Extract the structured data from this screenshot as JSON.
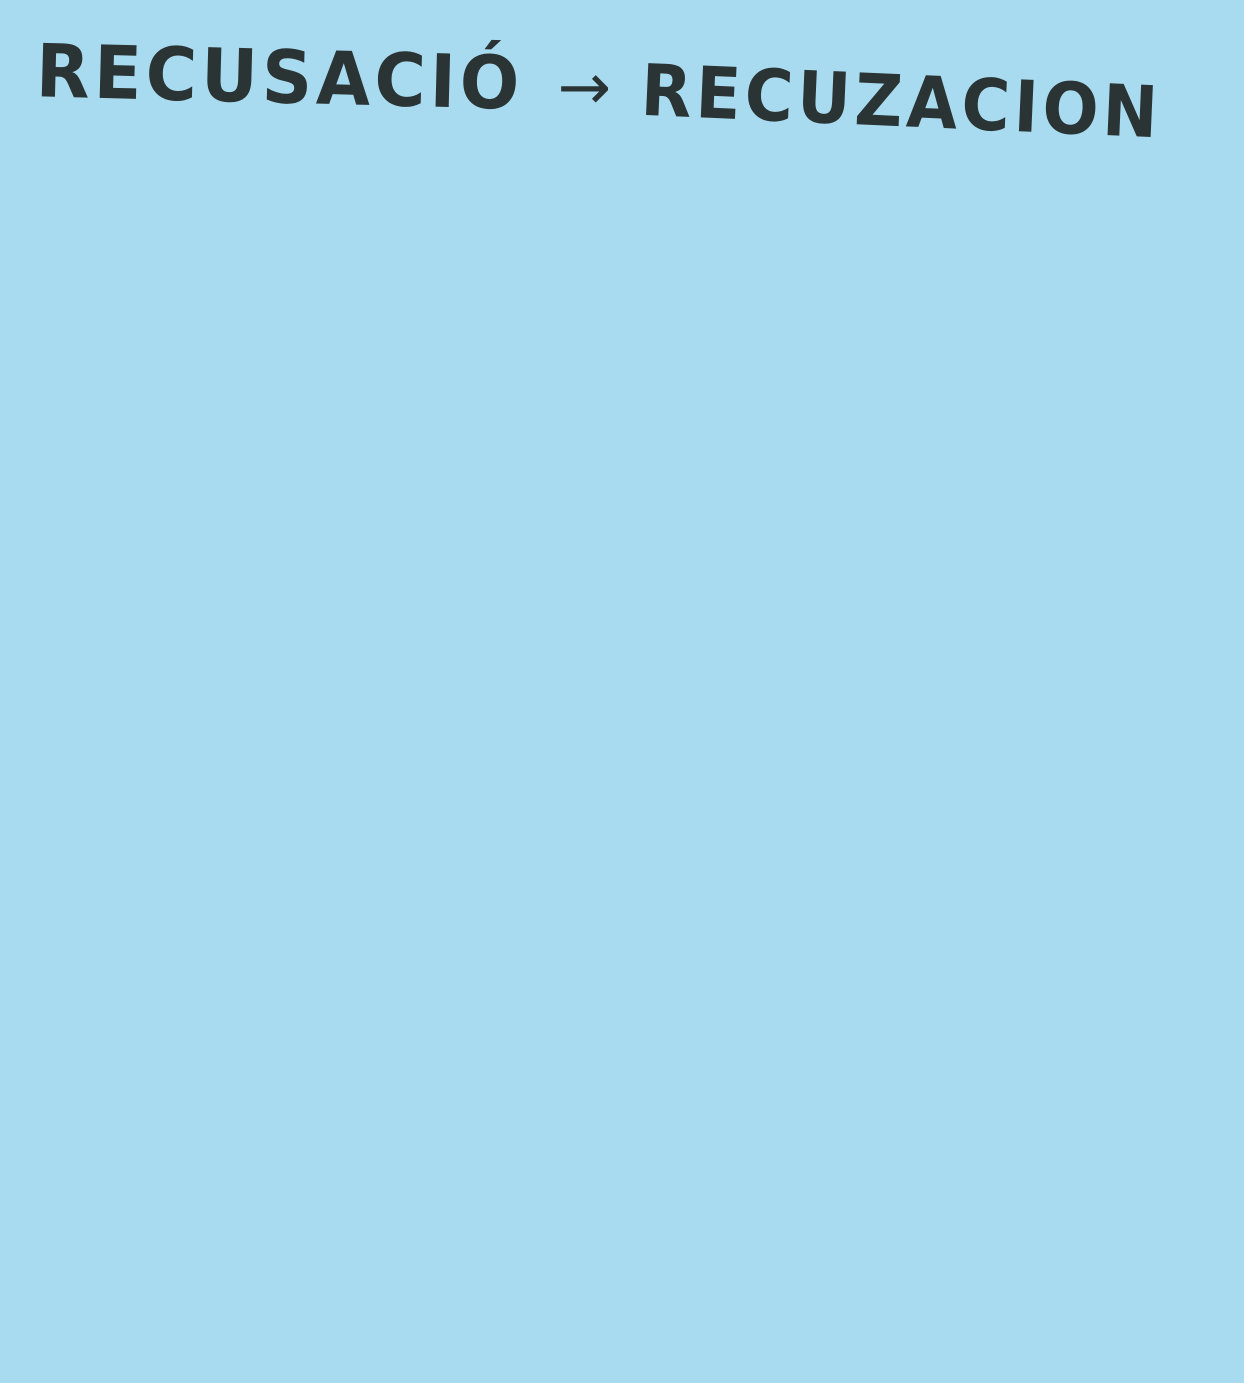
{
  "note": {
    "background_color": "#a8dbf0",
    "ink_color": "#2b3434",
    "original_word": "RECUSACIÓ",
    "arrow_glyph": "→",
    "corrected_word": "RECUZACION"
  }
}
